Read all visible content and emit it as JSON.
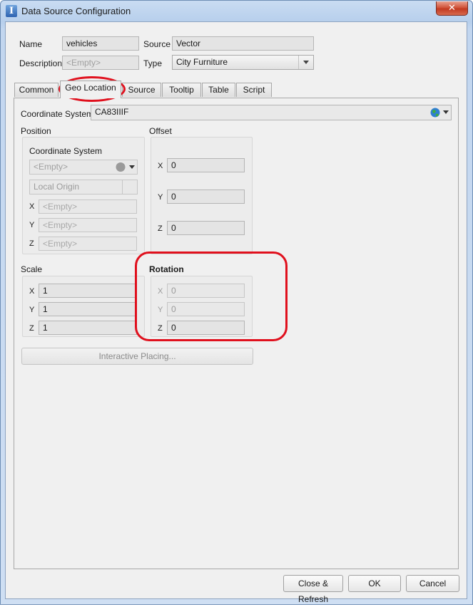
{
  "window": {
    "title": "Data Source Configuration",
    "icon_name": "app-i-icon",
    "close_label": "✕"
  },
  "info": {
    "name_label": "Name",
    "name_value": "vehicles",
    "source_label": "Source",
    "source_value": "Vector",
    "description_label": "Description",
    "description_placeholder": "<Empty>",
    "type_label": "Type",
    "type_value": "City Furniture"
  },
  "tabs": [
    {
      "label": "Common"
    },
    {
      "label": "Geo Location"
    },
    {
      "label": "Source"
    },
    {
      "label": "Tooltip"
    },
    {
      "label": "Table"
    },
    {
      "label": "Script"
    }
  ],
  "active_tab": "Geo Location",
  "geo": {
    "coord_system_label": "Coordinate System",
    "coord_system_value": "CA83IIIF",
    "position": {
      "title": "Position",
      "coord_system_label": "Coordinate System",
      "coord_system_placeholder": "<Empty>",
      "origin_value": "Local Origin",
      "x_label": "X",
      "x_placeholder": "<Empty>",
      "y_label": "Y",
      "y_placeholder": "<Empty>",
      "z_label": "Z",
      "z_placeholder": "<Empty>"
    },
    "offset": {
      "title": "Offset",
      "x_label": "X",
      "x_value": "0",
      "y_label": "Y",
      "y_value": "0",
      "z_label": "Z",
      "z_value": "0"
    },
    "scale": {
      "title": "Scale",
      "x_label": "X",
      "x_value": "1",
      "y_label": "Y",
      "y_value": "1",
      "z_label": "Z",
      "z_value": "1"
    },
    "rotation": {
      "title": "Rotation",
      "x_label": "X",
      "x_value": "0",
      "y_label": "Y",
      "y_value": "0",
      "z_label": "Z",
      "z_value": "0"
    },
    "interactive_placing_label": "Interactive Placing..."
  },
  "footer": {
    "close_refresh_label": "Close & Refresh",
    "ok_label": "OK",
    "cancel_label": "Cancel"
  },
  "colors": {
    "highlight": "#e0101d",
    "title_bar": "#b7cfec",
    "panel": "#f0f0f0"
  }
}
